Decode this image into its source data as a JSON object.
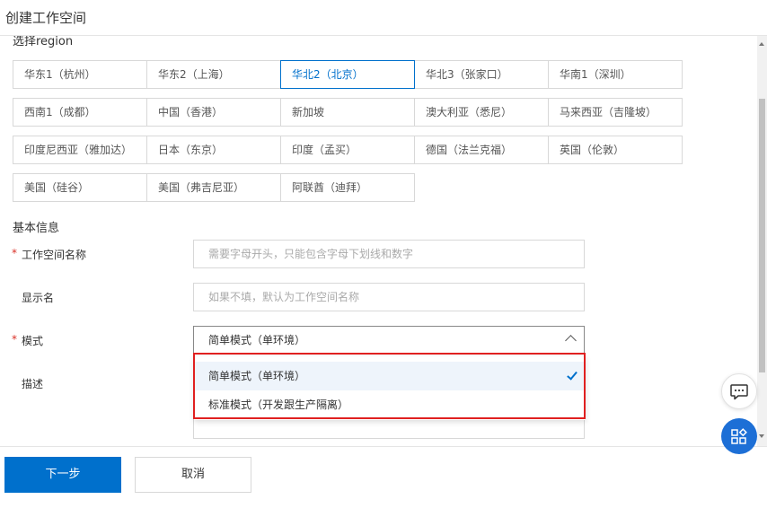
{
  "header": {
    "title": "创建工作空间"
  },
  "region_section": {
    "label": "选择region",
    "regions": [
      "华东1（杭州）",
      "华东2（上海）",
      "华北2（北京）",
      "华北3（张家口）",
      "华南1（深圳）",
      "西南1（成都）",
      "中国（香港）",
      "新加坡",
      "澳大利亚（悉尼）",
      "马来西亚（吉隆坡）",
      "印度尼西亚（雅加达）",
      "日本（东京）",
      "印度（孟买）",
      "德国（法兰克福）",
      "英国（伦敦）",
      "美国（硅谷）",
      "美国（弗吉尼亚）",
      "阿联酋（迪拜）"
    ],
    "selected": "华北2（北京）"
  },
  "basic_info": {
    "title": "基本信息",
    "workspace_name": {
      "label": "工作空间名称",
      "required_mark": "*",
      "placeholder": "需要字母开头，只能包含字母下划线和数字",
      "value": ""
    },
    "display_name": {
      "label": "显示名",
      "placeholder": "如果不填，默认为工作空间名称",
      "value": ""
    },
    "mode": {
      "label": "模式",
      "required_mark": "*",
      "value": "简单模式（单环境）",
      "options": [
        "简单模式（单环境）",
        "标准模式（开发跟生产隔离）"
      ]
    },
    "description": {
      "label": "描述"
    }
  },
  "footer": {
    "next_label": "下一步",
    "cancel_label": "取消"
  },
  "icons": {
    "chat": "chat-bubble-icon",
    "apps": "apps-grid-icon",
    "check": "checkmark-icon",
    "chevron": "chevron-up-icon"
  },
  "colors": {
    "accent": "#0070cc",
    "highlight": "#e02020",
    "required": "#d93026"
  }
}
